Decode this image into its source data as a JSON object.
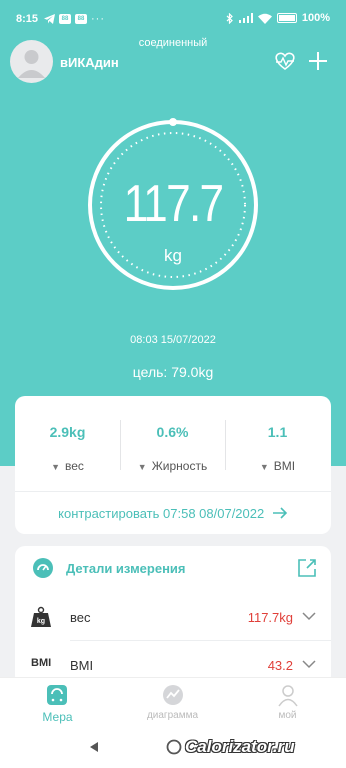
{
  "status_bar": {
    "time": "8:15",
    "chip1": "88",
    "chip2": "88",
    "battery": "100"
  },
  "header": {
    "status": "соединенный",
    "user_name": "вИКАдин"
  },
  "measurement": {
    "weight": "117.7",
    "unit": "kg",
    "datetime": "08:03 15/07/2022",
    "goal": "цель: 79.0kg"
  },
  "stats": [
    {
      "value": "2.9kg",
      "label": "вес"
    },
    {
      "value": "0.6%",
      "label": "Жирность"
    },
    {
      "value": "1.1",
      "label": "BMI"
    }
  ],
  "compare": {
    "label": "контрастировать 07:58 08/07/2022"
  },
  "details": {
    "title": "Детали измерения",
    "rows": [
      {
        "icon_text": "kg",
        "name": "вес",
        "value": "117.7kg"
      },
      {
        "icon_text": "BMI",
        "name": "BMI",
        "value": "43.2"
      }
    ]
  },
  "tabs": [
    {
      "label": "Мера"
    },
    {
      "label": "диаграмма"
    },
    {
      "label": "мой"
    }
  ],
  "colors": {
    "accent": "#5ccdc6",
    "value_red": "#e0403a"
  },
  "watermark": "Calorizator.ru"
}
